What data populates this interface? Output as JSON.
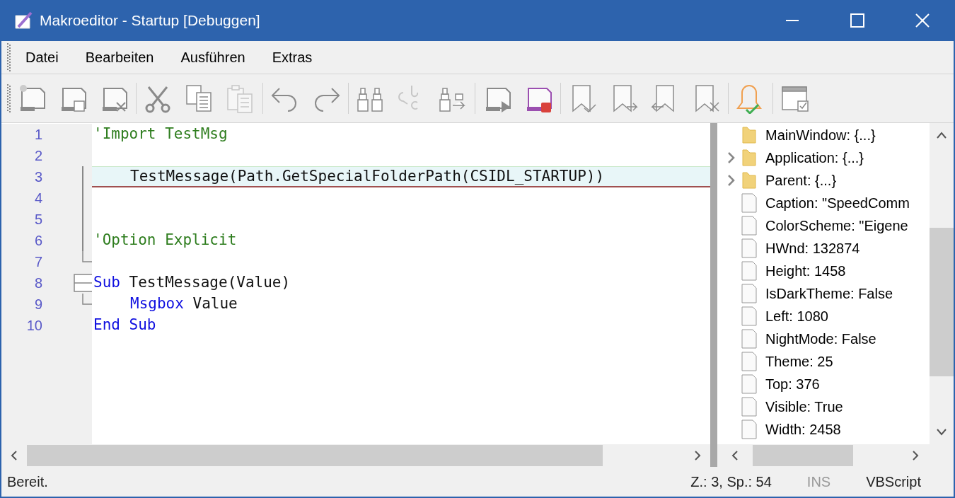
{
  "window": {
    "title": "Makroeditor - Startup [Debuggen]"
  },
  "menu": [
    "Datei",
    "Bearbeiten",
    "Ausführen",
    "Extras"
  ],
  "toolbar": [
    {
      "disabled": false
    },
    {
      "disabled": false
    },
    {
      "disabled": false
    },
    {
      "disabled": false
    },
    {
      "disabled": false
    },
    {
      "disabled": true
    },
    {
      "disabled": false
    },
    {
      "disabled": false
    },
    {
      "disabled": false
    },
    {
      "disabled": true
    },
    {
      "disabled": false
    },
    {
      "disabled": false
    },
    {
      "disabled": false
    },
    {
      "disabled": false
    },
    {
      "disabled": false
    },
    {
      "disabled": false
    },
    {
      "disabled": false
    },
    {
      "disabled": false
    },
    {
      "disabled": false
    }
  ],
  "editor": {
    "lines": [
      {
        "number": "1",
        "current": false,
        "kind": "plain",
        "indent": false,
        "tokens": [
          {
            "kind": "comment",
            "text": "'Import TestMsg"
          }
        ]
      },
      {
        "number": "2",
        "current": false,
        "kind": "plain"
      },
      {
        "number": "3",
        "current": true,
        "kind": "fold_line",
        "indent": true,
        "tokens": [
          {
            "kind": "plain",
            "text": "TestMessage(Path.GetSpecialFolderPath(CSIDL_STARTUP))"
          }
        ]
      },
      {
        "number": "4",
        "current": false,
        "kind": "fold_line"
      },
      {
        "number": "5",
        "current": false,
        "kind": "fold_line"
      },
      {
        "number": "6",
        "current": false,
        "kind": "fold_line",
        "indent": false,
        "tokens": [
          {
            "kind": "comment",
            "text": "'Option Explicit"
          }
        ]
      },
      {
        "number": "7",
        "current": false,
        "kind": "fold_end"
      },
      {
        "number": "8",
        "current": false,
        "kind": "fold_box",
        "indent": false,
        "tokens": [
          {
            "kind": "keyword",
            "text": "Sub"
          },
          {
            "kind": "plain",
            "text": " TestMessage(Value)"
          }
        ]
      },
      {
        "number": "9",
        "current": false,
        "kind": "fold_end",
        "indent": true,
        "tokens": [
          {
            "kind": "keyword",
            "text": "Msgbox"
          },
          {
            "kind": "plain",
            "text": " Value"
          }
        ]
      },
      {
        "number": "10",
        "current": false,
        "kind": "plain",
        "indent": false,
        "tokens": [
          {
            "kind": "keyword",
            "text": "End Sub"
          }
        ]
      }
    ]
  },
  "tree": [
    {
      "kind": "folder",
      "label": "MainWindow: {...}",
      "children": [
        {
          "kind": "folder",
          "label": "Application: {...}",
          "expanded": false
        },
        {
          "kind": "folder",
          "label": "Parent: {...}",
          "expanded": false
        },
        {
          "kind": "file",
          "label": "Caption: \"SpeedComm"
        },
        {
          "kind": "file",
          "label": "ColorScheme: \"Eigene"
        },
        {
          "kind": "file",
          "label": "HWnd: 132874"
        },
        {
          "kind": "file",
          "label": "Height: 1458"
        },
        {
          "kind": "file",
          "label": "IsDarkTheme: False"
        },
        {
          "kind": "file",
          "label": "Left: 1080"
        },
        {
          "kind": "file",
          "label": "NightMode: False"
        },
        {
          "kind": "file",
          "label": "Theme: 25"
        },
        {
          "kind": "file",
          "label": "Top: 376"
        },
        {
          "kind": "file",
          "label": "Visible: True"
        },
        {
          "kind": "file",
          "label": "Width: 2458"
        }
      ]
    }
  ],
  "status_bar": {
    "message": "Bereit.",
    "position": "Z.: 3, Sp.: 54",
    "mode": {
      "text": "INS",
      "active": false
    },
    "language": "VBScript"
  }
}
